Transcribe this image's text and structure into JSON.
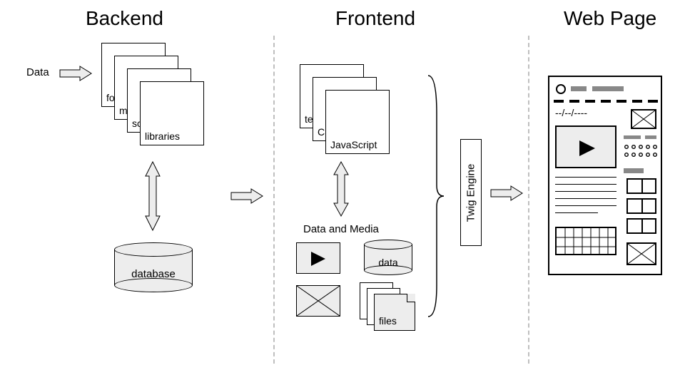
{
  "sections": {
    "backend": "Backend",
    "frontend": "Frontend",
    "webpage": "Web Page"
  },
  "backend": {
    "data_label": "Data",
    "stack": {
      "forms": "forms",
      "modules": "modules",
      "scripts": "scripts",
      "libraries": "libraries"
    },
    "database": "database"
  },
  "frontend": {
    "stack": {
      "templates": "templates",
      "css": "CSS",
      "javascript": "JavaScript"
    },
    "data_and_media": "Data and Media",
    "data_cyl": "data",
    "files": "files",
    "twig_engine": "Twig Engine"
  },
  "webpage": {
    "date_placeholder": "--/--/----"
  }
}
